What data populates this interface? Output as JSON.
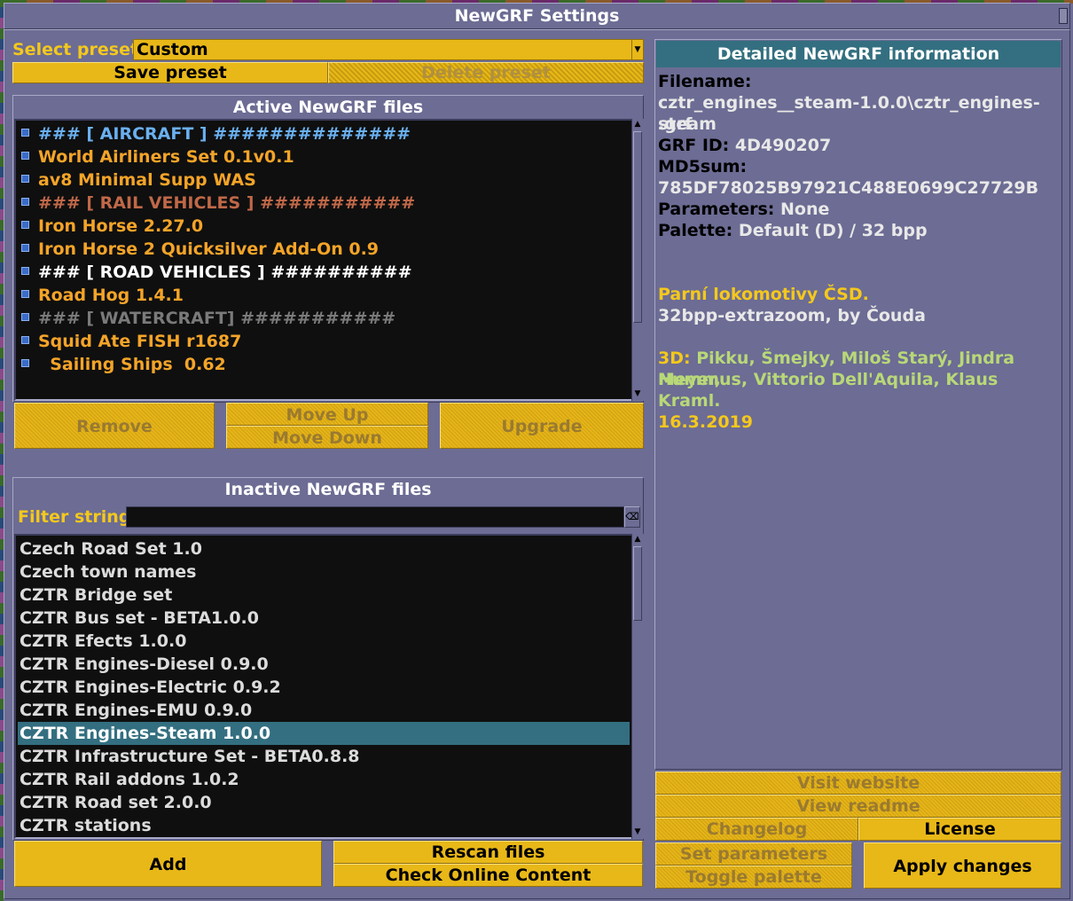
{
  "window": {
    "title": "NewGRF Settings"
  },
  "preset": {
    "label": "Select preset:",
    "value": "Custom",
    "save": "Save preset",
    "delete": "Delete preset"
  },
  "active": {
    "title": "Active NewGRF files",
    "items": [
      {
        "text": "### [ AIRCRAFT ] ##############",
        "color": "#6ab0f0"
      },
      {
        "text": "World Airliners Set 0.1v0.1",
        "color": "#f4a428"
      },
      {
        "text": "av8 Minimal Supp WAS",
        "color": "#f4a428"
      },
      {
        "text": "### [ RAIL VEHICLES ] ###########",
        "color": "#c06848"
      },
      {
        "text": "Iron Horse 2.27.0",
        "color": "#f4a428"
      },
      {
        "text": "Iron Horse 2 Quicksilver Add-On 0.9",
        "color": "#f4a428"
      },
      {
        "text": "### [ ROAD VEHICLES ] ##########",
        "color": "#ffffff"
      },
      {
        "text": "Road Hog 1.4.1",
        "color": "#f4a428"
      },
      {
        "text": "### [ WATERCRAFT] ###########",
        "color": "#7a7a7a"
      },
      {
        "text": "Squid Ate FISH r1687",
        "color": "#f4a428"
      },
      {
        "text": "  Sailing Ships  0.62",
        "color": "#f4a428"
      }
    ],
    "remove": "Remove",
    "move_up": "Move Up",
    "move_down": "Move Down",
    "upgrade": "Upgrade"
  },
  "inactive": {
    "title": "Inactive NewGRF files",
    "filter_label": "Filter string:",
    "filter_value": "",
    "items": [
      "Czech Road Set 1.0",
      "Czech town names",
      "CZTR Bridge set",
      "CZTR Bus set - BETA1.0.0",
      "CZTR Efects 1.0.0",
      "CZTR Engines-Diesel 0.9.0",
      "CZTR Engines-Electric 0.9.2",
      "CZTR Engines-EMU 0.9.0",
      "CZTR Engines-Steam 1.0.0",
      "CZTR Infrastructure Set - BETA0.8.8",
      "CZTR Rail addons 1.0.2",
      "CZTR Road set 2.0.0",
      "CZTR stations"
    ],
    "selected_index": 8,
    "add": "Add",
    "rescan": "Rescan files",
    "check_online": "Check Online Content"
  },
  "details": {
    "title": "Detailed NewGRF information",
    "filename_label": "Filename:",
    "filename_1": "cztr_engines__steam-1.0.0\\cztr_engines-steam",
    "filename_2": ".grf",
    "grfid_label": "GRF ID:",
    "grfid": "4D490207",
    "md5_label": "MD5sum:",
    "md5": "785DF78025B97921C488E0699C27729B",
    "params_label": "Parameters:",
    "params": "None",
    "palette_label": "Palette:",
    "palette": "Default (D) / 32 bpp",
    "desc_title": "Parní lokomotivy ČSD.",
    "desc_line": "32bpp-extrazoom, by Čouda",
    "credits_label": "3D:",
    "credits_1": "Pikku, Šmejky, Miloš Starý, Jindra Meyer,",
    "credits_2": "Hummus, Vittorio Dell'Aquila, Klaus Kraml.",
    "date": "16.3.2019"
  },
  "actions": {
    "visit_website": "Visit website",
    "view_readme": "View readme",
    "changelog": "Changelog",
    "license": "License",
    "set_parameters": "Set parameters",
    "toggle_palette": "Toggle palette",
    "apply": "Apply changes"
  }
}
